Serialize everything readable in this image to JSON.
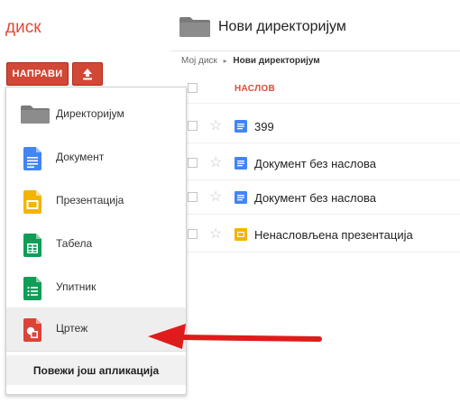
{
  "app": {
    "title": "диск"
  },
  "toolbar": {
    "create_label": "НАПРАВИ"
  },
  "header": {
    "folder_title": "Нови директоријум"
  },
  "breadcrumb": {
    "root": "Мој диск",
    "separator": "▸",
    "current": "Нови директоријум"
  },
  "list": {
    "column_title": "НАСЛОВ",
    "rows": [
      {
        "name": "399",
        "type": "document"
      },
      {
        "name": "Документ без наслова",
        "type": "document"
      },
      {
        "name": "Документ без наслова",
        "type": "document"
      },
      {
        "name": "Ненасловљена презентација",
        "type": "presentation"
      }
    ]
  },
  "menu": {
    "items": [
      {
        "label": "Директоријум",
        "icon": "folder-icon"
      },
      {
        "label": "Документ",
        "icon": "docs-icon"
      },
      {
        "label": "Презентација",
        "icon": "slides-icon"
      },
      {
        "label": "Табела",
        "icon": "sheets-icon"
      },
      {
        "label": "Упитник",
        "icon": "forms-icon"
      },
      {
        "label": "Цртеж",
        "icon": "drawings-icon"
      }
    ],
    "footer_label": "Повежи још апликација"
  },
  "colors": {
    "brand_red": "#dd4b39",
    "button_red": "#d14836",
    "docs_blue": "#4285f4",
    "slides_yellow": "#f4b400",
    "sheets_green": "#0f9d58",
    "drawings_red": "#db4437",
    "arrow_red": "#e01b1b"
  }
}
